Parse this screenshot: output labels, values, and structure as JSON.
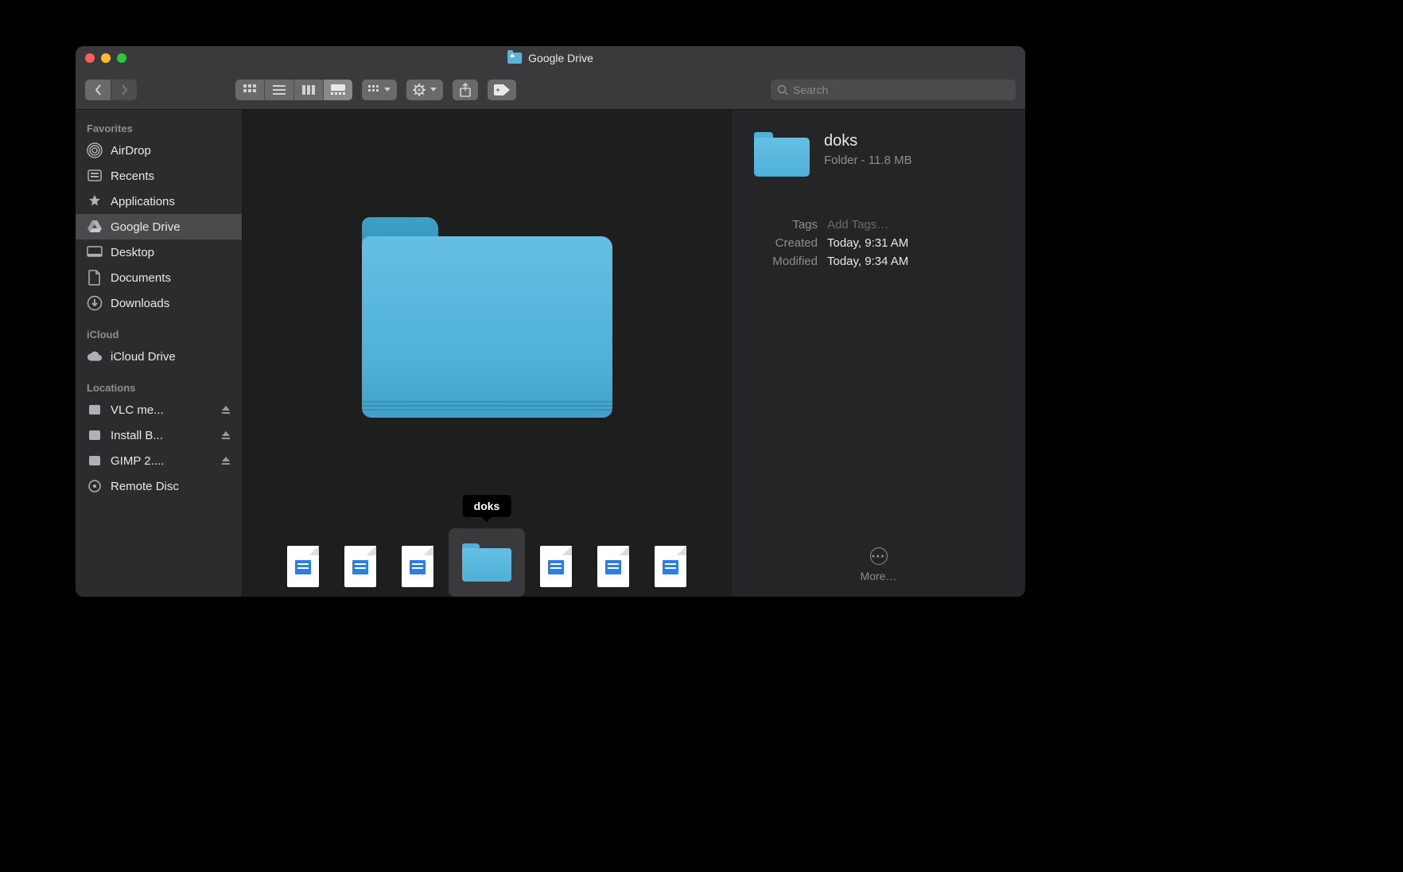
{
  "window": {
    "title": "Google Drive"
  },
  "search": {
    "placeholder": "Search"
  },
  "sidebar": {
    "favorites_header": "Favorites",
    "icloud_header": "iCloud",
    "locations_header": "Locations",
    "favorites": [
      {
        "label": "AirDrop",
        "icon": "airdrop"
      },
      {
        "label": "Recents",
        "icon": "recents"
      },
      {
        "label": "Applications",
        "icon": "applications"
      },
      {
        "label": "Google Drive",
        "icon": "googledrive",
        "selected": true
      },
      {
        "label": "Desktop",
        "icon": "desktop"
      },
      {
        "label": "Documents",
        "icon": "documents"
      },
      {
        "label": "Downloads",
        "icon": "downloads"
      }
    ],
    "icloud": [
      {
        "label": "iCloud Drive",
        "icon": "cloud"
      }
    ],
    "locations": [
      {
        "label": "VLC me...",
        "icon": "disk",
        "eject": true
      },
      {
        "label": "Install B...",
        "icon": "disk",
        "eject": true
      },
      {
        "label": "GIMP 2....",
        "icon": "disk",
        "eject": true
      },
      {
        "label": "Remote Disc",
        "icon": "remotedisc"
      }
    ]
  },
  "selected_item": {
    "name": "doks"
  },
  "cover_strip": [
    {
      "type": "doc"
    },
    {
      "type": "doc"
    },
    {
      "type": "doc"
    },
    {
      "type": "folder",
      "selected": true
    },
    {
      "type": "doc"
    },
    {
      "type": "doc"
    },
    {
      "type": "doc"
    }
  ],
  "info": {
    "name": "doks",
    "kind_size": "Folder - 11.8 MB",
    "tags_label": "Tags",
    "tags_value": "Add Tags…",
    "created_label": "Created",
    "created_value": "Today, 9:31 AM",
    "modified_label": "Modified",
    "modified_value": "Today, 9:34 AM",
    "more_label": "More…"
  }
}
